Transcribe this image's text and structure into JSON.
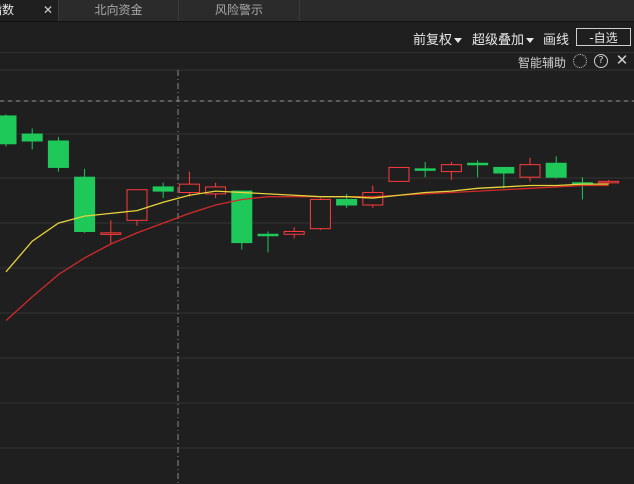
{
  "tabs": [
    {
      "label": "指数",
      "active": true,
      "closable": true
    },
    {
      "label": "北向资金",
      "active": false
    },
    {
      "label": "风险警示",
      "active": false
    }
  ],
  "toolbar": {
    "fq_label": "前复权",
    "overlay_label": "超级叠加",
    "draw_label": "画线",
    "watchlist_label": "-自选"
  },
  "assist": {
    "label": "智能辅助",
    "settings_icon": "gear-icon",
    "help_icon": "help-icon",
    "close_icon": "close-icon"
  },
  "colors": {
    "up": "#ff3b3b",
    "down": "#1ec95a",
    "ma_short": "#e6d43a",
    "ma_long": "#d22a2a",
    "grid": "#333333",
    "crosshair": "#8a8a8a"
  },
  "chart_data": {
    "type": "candlestick",
    "title": "",
    "grid": true,
    "candles": [
      {
        "o": 0.92,
        "c": 0.72,
        "h": 0.93,
        "l": 0.7
      },
      {
        "o": 0.79,
        "c": 0.74,
        "h": 0.83,
        "l": 0.68
      },
      {
        "o": 0.74,
        "c": 0.55,
        "h": 0.77,
        "l": 0.52
      },
      {
        "o": 0.48,
        "c": 0.09,
        "h": 0.54,
        "l": 0.08
      },
      {
        "o": 0.08,
        "c": 0.08,
        "h": 0.17,
        "l": 0.0
      },
      {
        "o": 0.17,
        "c": 0.39,
        "h": 0.39,
        "l": 0.13
      },
      {
        "o": 0.41,
        "c": 0.38,
        "h": 0.44,
        "l": 0.33
      },
      {
        "o": 0.37,
        "c": 0.43,
        "h": 0.52,
        "l": 0.34
      },
      {
        "o": 0.36,
        "c": 0.41,
        "h": 0.44,
        "l": 0.33
      },
      {
        "o": 0.38,
        "c": 0.01,
        "h": 0.38,
        "l": -0.04
      },
      {
        "o": 0.07,
        "c": 0.06,
        "h": 0.09,
        "l": -0.06
      },
      {
        "o": 0.07,
        "c": 0.09,
        "h": 0.12,
        "l": 0.04
      },
      {
        "o": 0.11,
        "c": 0.32,
        "h": 0.33,
        "l": 0.1
      },
      {
        "o": 0.32,
        "c": 0.28,
        "h": 0.36,
        "l": 0.26
      },
      {
        "o": 0.28,
        "c": 0.37,
        "h": 0.42,
        "l": 0.26
      },
      {
        "o": 0.45,
        "c": 0.55,
        "h": 0.55,
        "l": 0.45
      },
      {
        "o": 0.54,
        "c": 0.53,
        "h": 0.59,
        "l": 0.48
      },
      {
        "o": 0.52,
        "c": 0.57,
        "h": 0.59,
        "l": 0.46
      },
      {
        "o": 0.58,
        "c": 0.57,
        "h": 0.6,
        "l": 0.48
      },
      {
        "o": 0.55,
        "c": 0.51,
        "h": 0.55,
        "l": 0.4
      },
      {
        "o": 0.48,
        "c": 0.57,
        "h": 0.62,
        "l": 0.45
      },
      {
        "o": 0.58,
        "c": 0.48,
        "h": 0.63,
        "l": 0.47
      },
      {
        "o": 0.44,
        "c": 0.43,
        "h": 0.48,
        "l": 0.32
      },
      {
        "o": 0.44,
        "c": 0.45,
        "h": 0.46,
        "l": 0.43
      }
    ],
    "ma_short": [
      -0.2,
      0.02,
      0.15,
      0.2,
      0.22,
      0.24,
      0.3,
      0.35,
      0.38,
      0.37,
      0.36,
      0.35,
      0.34,
      0.34,
      0.33,
      0.35,
      0.37,
      0.38,
      0.4,
      0.41,
      0.42,
      0.42,
      0.43,
      0.43
    ],
    "ma_long": [
      -0.55,
      -0.38,
      -0.22,
      -0.1,
      0.0,
      0.08,
      0.15,
      0.22,
      0.28,
      0.32,
      0.34,
      0.34,
      0.34,
      0.34,
      0.34,
      0.35,
      0.36,
      0.37,
      0.38,
      0.39,
      0.4,
      0.41,
      0.42,
      0.42
    ]
  }
}
